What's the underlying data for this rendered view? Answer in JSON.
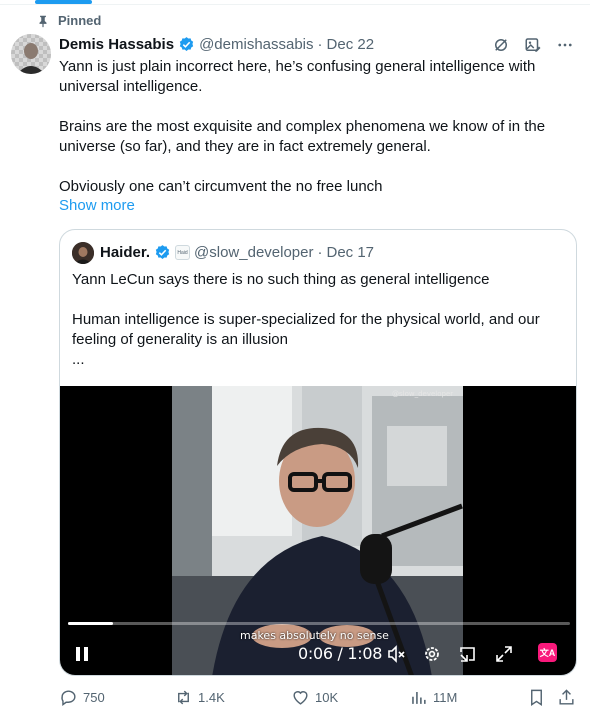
{
  "pinned": {
    "label": "Pinned"
  },
  "tweet": {
    "author_name": "Demis Hassabis",
    "author_handle": "@demishassabis",
    "separator": "·",
    "date": "Dec 22",
    "paragraphs": [
      "Yann is just plain incorrect here, he’s confusing general intelligence with universal intelligence.",
      "Brains are the most exquisite and complex phenomena we know of in the universe (so far), and they are in fact extremely general.",
      "Obviously one can’t circumvent the no free lunch"
    ],
    "show_more": "Show more"
  },
  "quote": {
    "author_name": "Haider.",
    "org_badge": "Haid",
    "author_handle": "@slow_developer",
    "separator": "·",
    "date": "Dec 17",
    "paragraphs": [
      "Yann LeCun says there is no such thing as general intelligence",
      "Human intelligence is super-specialized for the physical world, and our feeling of generality is an illusion",
      "..."
    ],
    "video": {
      "watermark": "@slow_developer",
      "caption": "makes absolutely no sense",
      "time": "0:06 / 1:08",
      "progress": 0.09,
      "translate_label": "文A"
    }
  },
  "actions": {
    "replies": "750",
    "reposts": "1.4K",
    "likes": "10K",
    "views": "11M"
  },
  "colors": {
    "accent": "#1d9bf0",
    "secondary_text": "#536471",
    "border": "#cfd9de",
    "translate_badge": "#f9197b"
  }
}
